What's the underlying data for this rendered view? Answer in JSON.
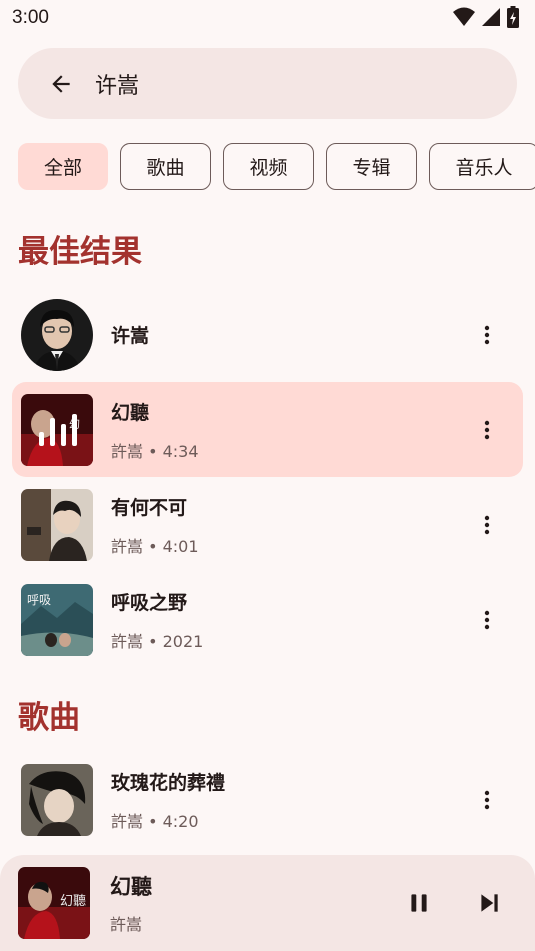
{
  "status_bar": {
    "time": "3:00"
  },
  "search": {
    "query": "许嵩"
  },
  "chips": [
    "全部",
    "歌曲",
    "视频",
    "专辑",
    "音乐人"
  ],
  "sections": {
    "best": "最佳结果",
    "songs": "歌曲"
  },
  "best_results": [
    {
      "title": "许嵩",
      "subtitle": ""
    },
    {
      "title": "幻聽",
      "subtitle": "許嵩 • 4:34",
      "playing": true
    },
    {
      "title": "有何不可",
      "subtitle": "許嵩 • 4:01"
    },
    {
      "title": "呼吸之野",
      "subtitle": "許嵩 • 2021"
    }
  ],
  "songs": [
    {
      "title": "玫瑰花的葬禮",
      "subtitle": "許嵩 • 4:20"
    }
  ],
  "player": {
    "title": "幻聽",
    "artist": "許嵩"
  },
  "colors": {
    "accent": "#a3322e",
    "selected_bg": "#ffdad5",
    "surface": "#f4e6e4",
    "background": "#fdf7f6"
  }
}
